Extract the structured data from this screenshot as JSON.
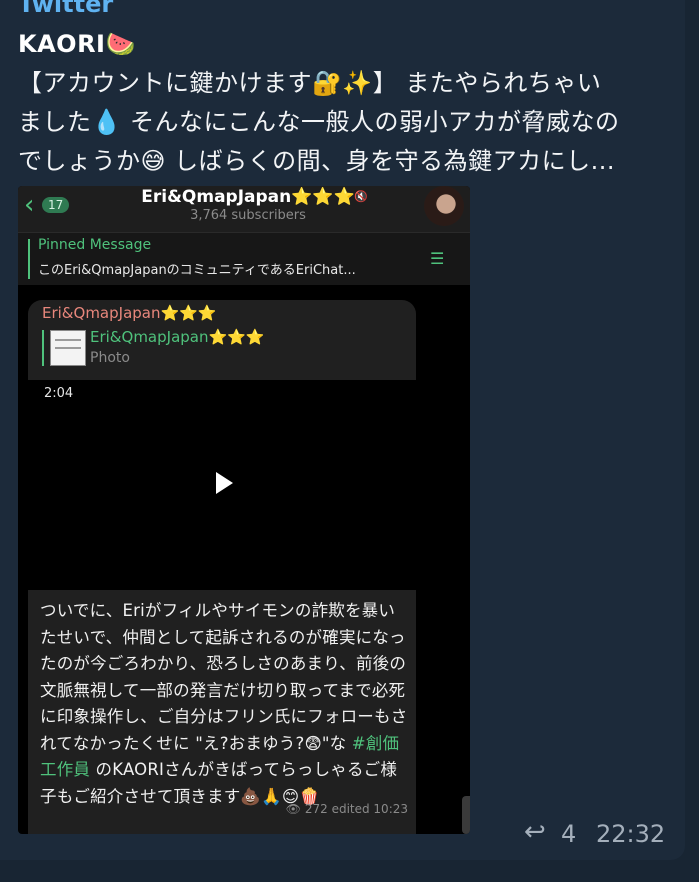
{
  "post": {
    "source_label": "Twitter",
    "author": "KAORI🍉",
    "body_line_1": "【アカウントに鍵かけます🔐✨】 またやられちゃい",
    "body_line_2": "ました💧 そんなにこんな一般人の弱小アカが脅威なの",
    "body_line_3": "でしょうか😅 しばらくの間、身を守る為鍵アカにし..."
  },
  "embedded_screenshot": {
    "header": {
      "back_badge": "17",
      "channel_title": "Eri&QmapJapan⭐⭐⭐",
      "subscribers": "3,764 subscribers"
    },
    "pinned": {
      "title": "Pinned Message",
      "text": "このEri&QmapJapanのコミュニティであるEriChat..."
    },
    "message": {
      "sender": "Eri&QmapJapan⭐⭐⭐",
      "forward_name": "Eri&QmapJapan⭐⭐⭐",
      "forward_kind": "Photo",
      "video_duration": "2:04",
      "caption_part_1": "ついでに、Eriがフィルやサイモンの詐欺を暴いたせいで、仲間として起訴されるのが確実になったのが今ごろわかり、恐ろしさのあまり、前後の文脈無視して一部の発言だけ切り取ってまで必死に印象操作し、ご自分はフリン氏にフォローもされてなかったくせに \"え?おまゆう?😨\"な ",
      "hashtag": "#創価工作員",
      "caption_part_2": " のKAORIさんがきばってらっしゃるご様子もご紹介させて頂きます💩🙏😊🍿",
      "views_edited": "👁 272 edited 10:23"
    }
  },
  "footer": {
    "reply_count": "4",
    "time": "22:32"
  }
}
